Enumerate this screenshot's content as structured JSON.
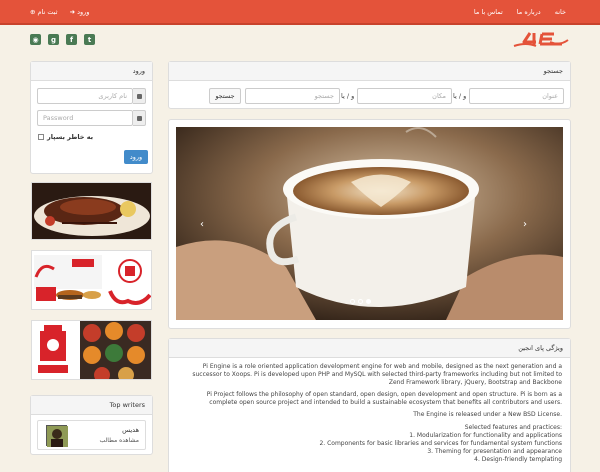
{
  "topbar": {
    "nav": [
      {
        "label": "خانه"
      },
      {
        "label": "درباره ما"
      },
      {
        "label": "تماس با ما"
      }
    ],
    "login_label": "ورود",
    "register_label": "ثبت نام"
  },
  "social": [
    "twitter-icon",
    "facebook-icon",
    "googleplus-icon",
    "rss-icon"
  ],
  "search": {
    "title": "جستجو",
    "title_placeholder": "عنوان",
    "and_or_1": "و / یا",
    "place_placeholder": "مکان",
    "and_or_2": "و / یا",
    "keyword_placeholder": "جستجو",
    "button": "جستجو"
  },
  "login": {
    "title": "ورود",
    "username_placeholder": "نام کاربری",
    "password_placeholder": "Password",
    "remember": "به خاطر بسپار",
    "submit": "ورود"
  },
  "features": {
    "title": "ویژگی پای انجین",
    "paragraphs": [
      "Pi Engine is a role oriented application development engine for web and mobile, designed as the next generation and a successor to Xoops. Pi is developed upon PHP and MySQL with selected third-party frameworks including but not limited to Zend Framework library, jQuery, Bootstrap and Backbone",
      "Pi Project follows the philosophy of open standard, open design, open development and open structure. Pi is born as a complete open source project and intended to build a sustainable ecosystem that benefits all contributors and users.",
      "The Engine is released under a New BSD License."
    ],
    "list_title": "Selected features and practices:",
    "list": [
      "1. Modularization for functionality and applications",
      "2. Components for basic libraries and services for fundamental system functions",
      "3. Theming for presentation and appearance",
      "4. Design-friendly templating"
    ]
  },
  "writers": {
    "title": "Top writers",
    "name": "هدیس",
    "link": "مشاهده مطالب"
  },
  "colors": {
    "accent": "#e4533a",
    "primary_button": "#428bca"
  }
}
